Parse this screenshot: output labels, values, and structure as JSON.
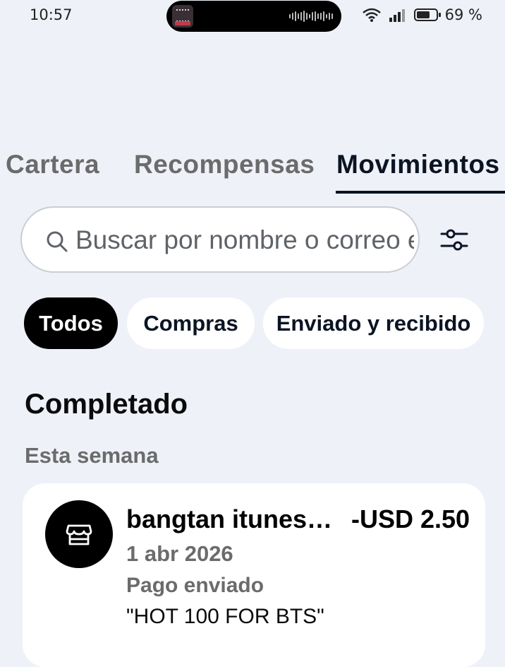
{
  "status_bar": {
    "time": "10:57",
    "battery_percent": "69 %",
    "battery_level": 0.69,
    "icons": [
      "wifi-icon",
      "signal-icon",
      "battery-icon"
    ]
  },
  "tabs": [
    {
      "label": "Cartera",
      "active": false
    },
    {
      "label": "Recompensas",
      "active": false
    },
    {
      "label": "Movimientos",
      "active": true
    }
  ],
  "search": {
    "placeholder": "Buscar por nombre o correo electrónico",
    "value": ""
  },
  "filters": [
    {
      "label": "Todos",
      "active": true
    },
    {
      "label": "Compras",
      "active": false
    },
    {
      "label": "Enviado y recibido",
      "active": false
    }
  ],
  "section": {
    "title": "Completado",
    "group_label": "Esta semana"
  },
  "transactions": [
    {
      "merchant": "bangtan itunes purchase",
      "amount": "-USD 2.50",
      "date": "1 abr 2026",
      "status": "Pago enviado",
      "note": "\"HOT 100 FOR BTS\"",
      "icon": "store-icon"
    }
  ],
  "colors": {
    "background": "#eef1f8",
    "primary_dark": "#0b1423",
    "muted_text": "#6b6b6b",
    "card": "#ffffff"
  }
}
